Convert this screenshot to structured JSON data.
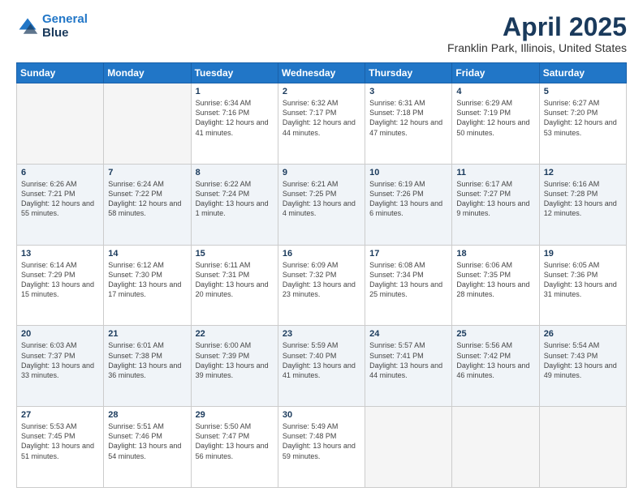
{
  "header": {
    "logo_line1": "General",
    "logo_line2": "Blue",
    "title": "April 2025",
    "subtitle": "Franklin Park, Illinois, United States"
  },
  "weekdays": [
    "Sunday",
    "Monday",
    "Tuesday",
    "Wednesday",
    "Thursday",
    "Friday",
    "Saturday"
  ],
  "weeks": [
    [
      {
        "day": "",
        "info": ""
      },
      {
        "day": "",
        "info": ""
      },
      {
        "day": "1",
        "info": "Sunrise: 6:34 AM\nSunset: 7:16 PM\nDaylight: 12 hours and 41 minutes."
      },
      {
        "day": "2",
        "info": "Sunrise: 6:32 AM\nSunset: 7:17 PM\nDaylight: 12 hours and 44 minutes."
      },
      {
        "day": "3",
        "info": "Sunrise: 6:31 AM\nSunset: 7:18 PM\nDaylight: 12 hours and 47 minutes."
      },
      {
        "day": "4",
        "info": "Sunrise: 6:29 AM\nSunset: 7:19 PM\nDaylight: 12 hours and 50 minutes."
      },
      {
        "day": "5",
        "info": "Sunrise: 6:27 AM\nSunset: 7:20 PM\nDaylight: 12 hours and 53 minutes."
      }
    ],
    [
      {
        "day": "6",
        "info": "Sunrise: 6:26 AM\nSunset: 7:21 PM\nDaylight: 12 hours and 55 minutes."
      },
      {
        "day": "7",
        "info": "Sunrise: 6:24 AM\nSunset: 7:22 PM\nDaylight: 12 hours and 58 minutes."
      },
      {
        "day": "8",
        "info": "Sunrise: 6:22 AM\nSunset: 7:24 PM\nDaylight: 13 hours and 1 minute."
      },
      {
        "day": "9",
        "info": "Sunrise: 6:21 AM\nSunset: 7:25 PM\nDaylight: 13 hours and 4 minutes."
      },
      {
        "day": "10",
        "info": "Sunrise: 6:19 AM\nSunset: 7:26 PM\nDaylight: 13 hours and 6 minutes."
      },
      {
        "day": "11",
        "info": "Sunrise: 6:17 AM\nSunset: 7:27 PM\nDaylight: 13 hours and 9 minutes."
      },
      {
        "day": "12",
        "info": "Sunrise: 6:16 AM\nSunset: 7:28 PM\nDaylight: 13 hours and 12 minutes."
      }
    ],
    [
      {
        "day": "13",
        "info": "Sunrise: 6:14 AM\nSunset: 7:29 PM\nDaylight: 13 hours and 15 minutes."
      },
      {
        "day": "14",
        "info": "Sunrise: 6:12 AM\nSunset: 7:30 PM\nDaylight: 13 hours and 17 minutes."
      },
      {
        "day": "15",
        "info": "Sunrise: 6:11 AM\nSunset: 7:31 PM\nDaylight: 13 hours and 20 minutes."
      },
      {
        "day": "16",
        "info": "Sunrise: 6:09 AM\nSunset: 7:32 PM\nDaylight: 13 hours and 23 minutes."
      },
      {
        "day": "17",
        "info": "Sunrise: 6:08 AM\nSunset: 7:34 PM\nDaylight: 13 hours and 25 minutes."
      },
      {
        "day": "18",
        "info": "Sunrise: 6:06 AM\nSunset: 7:35 PM\nDaylight: 13 hours and 28 minutes."
      },
      {
        "day": "19",
        "info": "Sunrise: 6:05 AM\nSunset: 7:36 PM\nDaylight: 13 hours and 31 minutes."
      }
    ],
    [
      {
        "day": "20",
        "info": "Sunrise: 6:03 AM\nSunset: 7:37 PM\nDaylight: 13 hours and 33 minutes."
      },
      {
        "day": "21",
        "info": "Sunrise: 6:01 AM\nSunset: 7:38 PM\nDaylight: 13 hours and 36 minutes."
      },
      {
        "day": "22",
        "info": "Sunrise: 6:00 AM\nSunset: 7:39 PM\nDaylight: 13 hours and 39 minutes."
      },
      {
        "day": "23",
        "info": "Sunrise: 5:59 AM\nSunset: 7:40 PM\nDaylight: 13 hours and 41 minutes."
      },
      {
        "day": "24",
        "info": "Sunrise: 5:57 AM\nSunset: 7:41 PM\nDaylight: 13 hours and 44 minutes."
      },
      {
        "day": "25",
        "info": "Sunrise: 5:56 AM\nSunset: 7:42 PM\nDaylight: 13 hours and 46 minutes."
      },
      {
        "day": "26",
        "info": "Sunrise: 5:54 AM\nSunset: 7:43 PM\nDaylight: 13 hours and 49 minutes."
      }
    ],
    [
      {
        "day": "27",
        "info": "Sunrise: 5:53 AM\nSunset: 7:45 PM\nDaylight: 13 hours and 51 minutes."
      },
      {
        "day": "28",
        "info": "Sunrise: 5:51 AM\nSunset: 7:46 PM\nDaylight: 13 hours and 54 minutes."
      },
      {
        "day": "29",
        "info": "Sunrise: 5:50 AM\nSunset: 7:47 PM\nDaylight: 13 hours and 56 minutes."
      },
      {
        "day": "30",
        "info": "Sunrise: 5:49 AM\nSunset: 7:48 PM\nDaylight: 13 hours and 59 minutes."
      },
      {
        "day": "",
        "info": ""
      },
      {
        "day": "",
        "info": ""
      },
      {
        "day": "",
        "info": ""
      }
    ]
  ]
}
